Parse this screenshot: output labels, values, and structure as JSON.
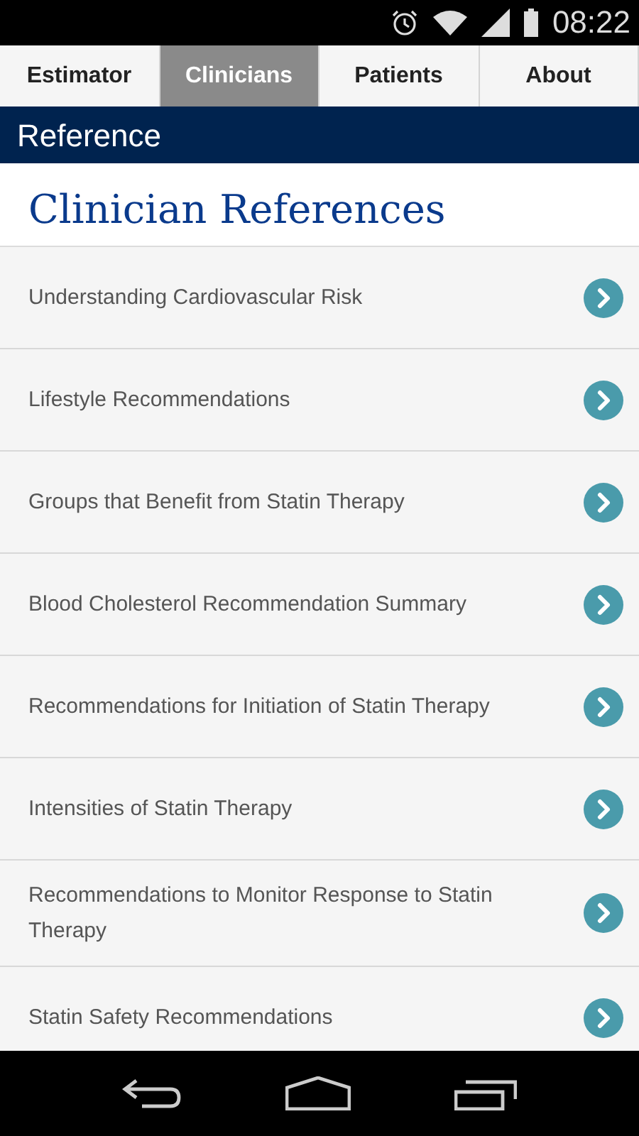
{
  "status_bar": {
    "time": "08:22"
  },
  "tabs": [
    {
      "label": "Estimator",
      "selected": false
    },
    {
      "label": "Clinicians",
      "selected": true
    },
    {
      "label": "Patients",
      "selected": false
    },
    {
      "label": "About",
      "selected": false
    }
  ],
  "header": {
    "title": "Reference"
  },
  "page_title": "Clinician References",
  "items": [
    {
      "label": "Understanding Cardiovascular Risk"
    },
    {
      "label": "Lifestyle Recommendations"
    },
    {
      "label": "Groups that Benefit from Statin Therapy"
    },
    {
      "label": "Blood Cholesterol Recommendation Summary"
    },
    {
      "label": "Recommendations for Initiation of Statin Therapy"
    },
    {
      "label": "Intensities of Statin Therapy"
    },
    {
      "label": "Recommendations to Monitor Response to Statin Therapy"
    },
    {
      "label": "Statin Safety Recommendations"
    }
  ]
}
